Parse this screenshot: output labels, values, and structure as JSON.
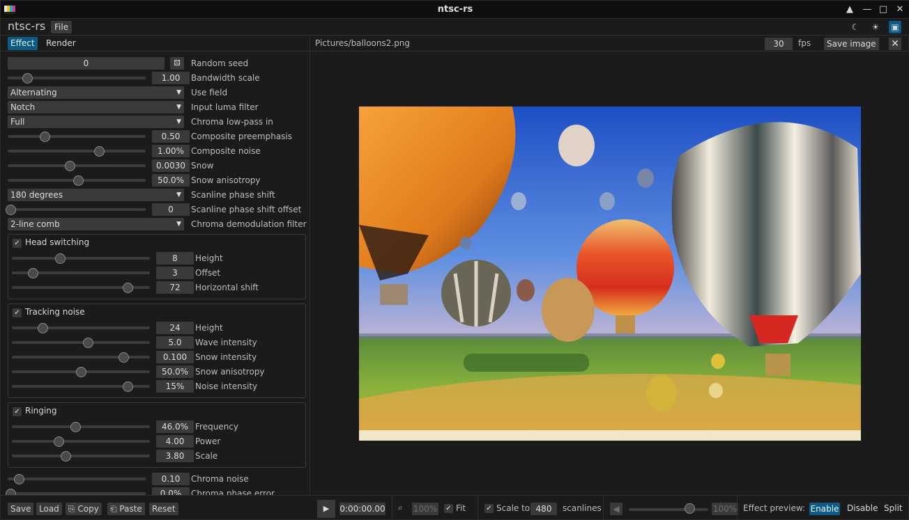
{
  "window": {
    "title": "ntsc-rs"
  },
  "menubar": {
    "app_name": "ntsc-rs",
    "file_label": "File"
  },
  "tabs": [
    {
      "label": "Effect",
      "active": true
    },
    {
      "label": "Render",
      "active": false
    }
  ],
  "seed": {
    "value": "0",
    "label": "Random seed"
  },
  "top_controls": [
    {
      "kind": "slider",
      "value": "1.00",
      "label": "Bandwidth scale",
      "fraction": 0.14
    },
    {
      "kind": "combo",
      "value": "Alternating",
      "label": "Use field"
    },
    {
      "kind": "combo",
      "value": "Notch",
      "label": "Input luma filter"
    },
    {
      "kind": "combo",
      "value": "Full",
      "label": "Chroma low-pass in"
    },
    {
      "kind": "slider",
      "value": "0.50",
      "label": "Composite preemphasis",
      "fraction": 0.27
    },
    {
      "kind": "slider",
      "value": "1.00%",
      "label": "Composite noise",
      "fraction": 0.66
    },
    {
      "kind": "slider",
      "value": "0.0030",
      "label": "Snow",
      "fraction": 0.45
    },
    {
      "kind": "slider",
      "value": "50.0%",
      "label": "Snow anisotropy",
      "fraction": 0.51
    },
    {
      "kind": "combo",
      "value": "180 degrees",
      "label": "Scanline phase shift"
    },
    {
      "kind": "slider",
      "value": "0",
      "label": "Scanline phase shift offset",
      "fraction": 0.02
    },
    {
      "kind": "combo",
      "value": "2-line comb",
      "label": "Chroma demodulation filter"
    }
  ],
  "groups": [
    {
      "title": "Head switching",
      "checked": true,
      "items": [
        {
          "value": "8",
          "label": "Height",
          "fraction": 0.35
        },
        {
          "value": "3",
          "label": "Offset",
          "fraction": 0.15
        },
        {
          "value": "72",
          "label": "Horizontal shift",
          "fraction": 0.84
        }
      ]
    },
    {
      "title": "Tracking noise",
      "checked": true,
      "items": [
        {
          "value": "24",
          "label": "Height",
          "fraction": 0.22
        },
        {
          "value": "5.0",
          "label": "Wave intensity",
          "fraction": 0.55
        },
        {
          "value": "0.100",
          "label": "Snow intensity",
          "fraction": 0.81
        },
        {
          "value": "50.0%",
          "label": "Snow anisotropy",
          "fraction": 0.5
        },
        {
          "value": "15%",
          "label": "Noise intensity",
          "fraction": 0.84
        }
      ]
    },
    {
      "title": "Ringing",
      "checked": true,
      "items": [
        {
          "value": "46.0%",
          "label": "Frequency",
          "fraction": 0.46
        },
        {
          "value": "4.00",
          "label": "Power",
          "fraction": 0.34
        },
        {
          "value": "3.80",
          "label": "Scale",
          "fraction": 0.39
        }
      ]
    }
  ],
  "bottom_controls": [
    {
      "kind": "slider",
      "value": "0.10",
      "label": "Chroma noise",
      "fraction": 0.08
    },
    {
      "kind": "slider",
      "value": "0.0%",
      "label": "Chroma phase error",
      "fraction": 0.02
    }
  ],
  "bottom_left_buttons": [
    {
      "label": "Save",
      "icon": ""
    },
    {
      "label": "Load",
      "icon": ""
    },
    {
      "label": "Copy",
      "icon": "copy-icon"
    },
    {
      "label": "Paste",
      "icon": "paste-icon"
    },
    {
      "label": "Reset",
      "icon": ""
    }
  ],
  "preview_header": {
    "path": "Pictures/balloons2.png",
    "fps": "30",
    "fps_label": "fps",
    "save_image_label": "Save image"
  },
  "playback": {
    "timecode": "0:00:00.00",
    "zoom": "100%",
    "fit_label": "Fit",
    "fit_checked": true,
    "scale_label": "Scale to",
    "scale_checked": true,
    "scanlines": "480",
    "scanlines_label": "scanlines",
    "volume": "100%",
    "volume_level": 0.76
  },
  "effect_preview": {
    "label": "Effect preview:",
    "options": [
      "Enable",
      "Disable",
      "Split"
    ],
    "selected": "Enable"
  },
  "colors": {
    "accent": "#0e5a85",
    "background": "#1b1b1b",
    "widget": "#3a3a3a"
  }
}
